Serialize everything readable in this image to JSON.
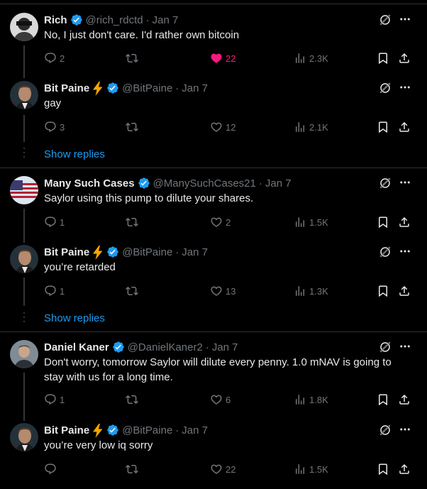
{
  "tweets": [
    {
      "name": "Rich",
      "handle": "@rich_rdctd",
      "date": "Jan 7",
      "text": "No, I just don't care. I'd rather own bitcoin",
      "replies": "2",
      "retweets": "",
      "likes": "22",
      "views": "2.3K",
      "liked": true,
      "avatar": "rich"
    },
    {
      "name": "Bit Paine",
      "handle": "@BitPaine",
      "date": "Jan 7",
      "text": "gay",
      "replies": "3",
      "retweets": "",
      "likes": "12",
      "views": "2.1K",
      "liked": false,
      "avatar": "bitpaine"
    },
    {
      "name": "Many Such Cases",
      "handle": "@ManySuchCases21",
      "date": "Jan 7",
      "text": "Saylor using this pump to dilute your shares.",
      "replies": "1",
      "retweets": "",
      "likes": "2",
      "views": "1.5K",
      "liked": false,
      "avatar": "flag"
    },
    {
      "name": "Bit Paine",
      "handle": "@BitPaine",
      "date": "Jan 7",
      "text": "you’re retarded",
      "replies": "1",
      "retweets": "",
      "likes": "13",
      "views": "1.3K",
      "liked": false,
      "avatar": "bitpaine"
    },
    {
      "name": "Daniel Kaner",
      "handle": "@DanielKaner2",
      "date": "Jan 7",
      "text": "Don't worry, tomorrow Saylor will dilute every penny. 1.0 mNAV is going to stay with us for a long time.",
      "replies": "1",
      "retweets": "",
      "likes": "6",
      "views": "1.8K",
      "liked": false,
      "avatar": "daniel"
    },
    {
      "name": "Bit Paine",
      "handle": "@BitPaine",
      "date": "Jan 7",
      "text": "you’re very low iq sorry",
      "replies": "",
      "retweets": "",
      "likes": "22",
      "views": "1.5K",
      "liked": false,
      "avatar": "bitpaine"
    }
  ],
  "show_replies_label": "Show replies",
  "colors": {
    "background": "#000000",
    "text": "#e7e9ea",
    "muted": "#71767b",
    "link": "#1d9bf0",
    "like": "#f91880",
    "verified": "#1d9bf0",
    "divider": "#2f3336"
  },
  "icons": [
    "reply-icon",
    "retweet-icon",
    "like-icon",
    "views-icon",
    "bookmark-icon",
    "share-icon",
    "grok-icon",
    "more-icon",
    "verified-icon",
    "lightning-icon"
  ]
}
